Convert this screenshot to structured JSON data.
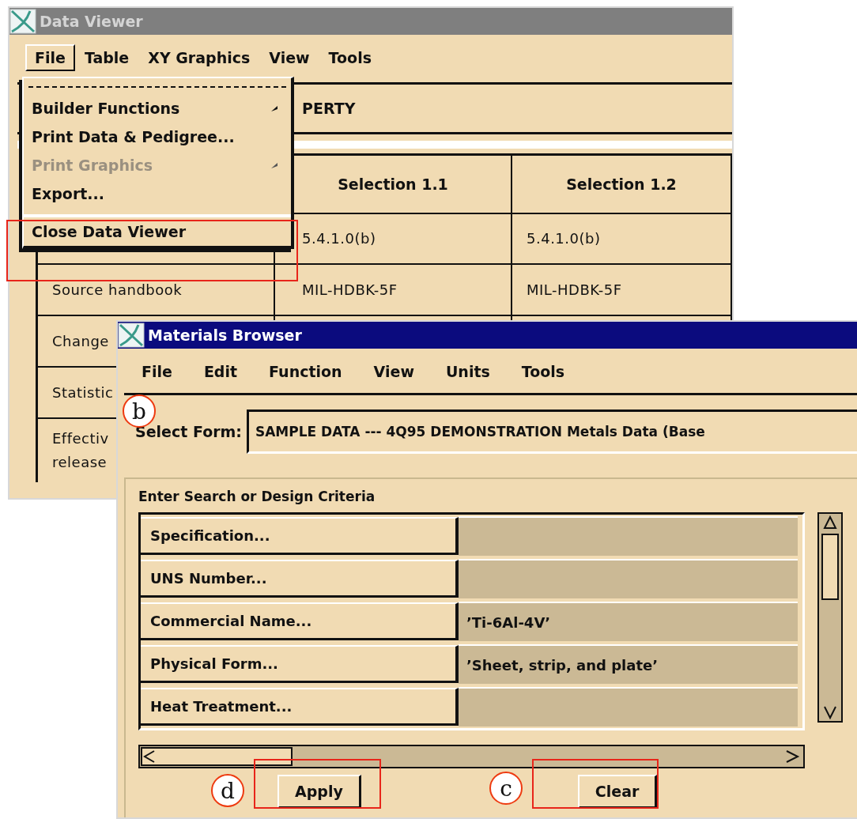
{
  "data_viewer": {
    "title": "Data Viewer",
    "menu": [
      {
        "label": "File",
        "selected": true
      },
      {
        "label": "Table",
        "selected": false
      },
      {
        "label": "XY Graphics",
        "selected": false
      },
      {
        "label": "View",
        "selected": false
      },
      {
        "label": "Tools",
        "selected": false
      }
    ],
    "banner": "PERTY",
    "columns": [
      "Selection 1.1",
      "Selection 1.2"
    ],
    "rows": [
      {
        "values": [
          "5.4.1.0(b)",
          "5.4.1.0(b)"
        ]
      },
      {
        "label_lines": [
          "Source handbook"
        ],
        "values": [
          "MIL-HDBK-5F",
          "MIL-HDBK-5F"
        ]
      },
      {
        "label_lines": [
          "Change"
        ]
      },
      {
        "label_lines": [
          "Statistic"
        ]
      },
      {
        "label_lines": [
          "Effectiv",
          "release"
        ]
      }
    ],
    "file_menu": [
      {
        "label": "Builder Functions",
        "submenu": true,
        "disabled": false
      },
      {
        "label": "Print Data & Pedigree...",
        "submenu": false,
        "disabled": false
      },
      {
        "label": "Print Graphics",
        "submenu": true,
        "disabled": true
      },
      {
        "label": "Export...",
        "submenu": false,
        "disabled": false
      },
      {
        "label": "Close Data Viewer",
        "submenu": false,
        "disabled": false,
        "separated": true
      }
    ]
  },
  "materials_browser": {
    "title": "Materials Browser",
    "menu": [
      "File",
      "Edit",
      "Function",
      "View",
      "Units",
      "Tools"
    ],
    "select_form": {
      "label": "Select Form:",
      "value": "SAMPLE DATA --- 4Q95 DEMONSTRATION Metals Data (Base"
    },
    "criteria": {
      "heading": "Enter Search or Design Criteria",
      "rows": [
        {
          "label": "Specification..."
        },
        {
          "label": "UNS Number..."
        },
        {
          "label": "Commercial Name...",
          "value": "’Ti-6Al-4V’"
        },
        {
          "label": "Physical Form...",
          "value": "’Sheet, strip, and plate’"
        },
        {
          "label": "Heat Treatment..."
        }
      ]
    },
    "buttons": [
      "Apply",
      "Clear"
    ]
  },
  "callouts": [
    {
      "label": "b"
    },
    {
      "label": "d"
    },
    {
      "label": "c"
    }
  ]
}
